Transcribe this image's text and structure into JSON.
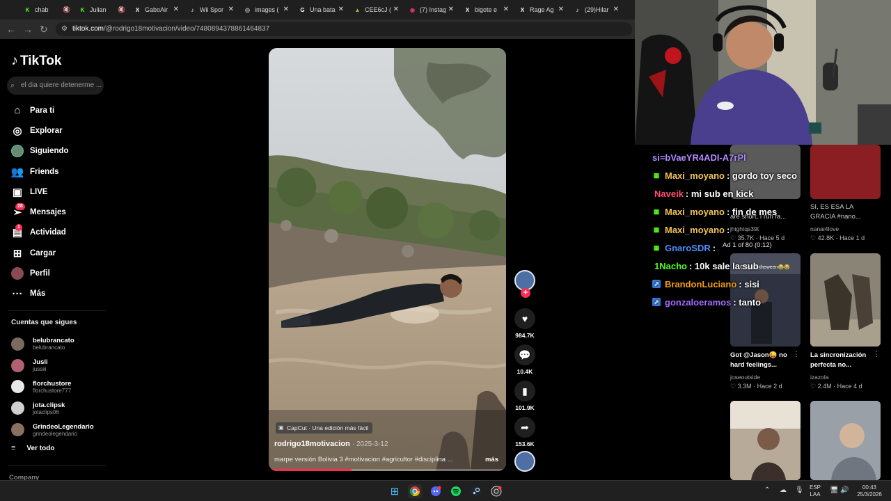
{
  "browser": {
    "tabs": [
      {
        "title": "chab",
        "fav": "K",
        "fav_color": "#53fc18",
        "muted": true
      },
      {
        "title": "Julian",
        "fav": "K",
        "fav_color": "#53fc18",
        "muted": true
      },
      {
        "title": "GaboAir",
        "fav": "X",
        "fav_color": "#ffffff",
        "muted": false
      },
      {
        "title": "Wii Spor",
        "fav": "♪",
        "fav_color": "#ffffff",
        "muted": false
      },
      {
        "title": "images (",
        "fav": "◎",
        "fav_color": "#bbbbbb",
        "muted": false
      },
      {
        "title": "Una bata",
        "fav": "G",
        "fav_color": "#ffffff",
        "muted": false
      },
      {
        "title": "CEE6cJ (",
        "fav": "▲",
        "fav_color": "#8bc34a",
        "muted": false
      },
      {
        "title": "(7) Instag",
        "fav": "◉",
        "fav_color": "#e1306c",
        "muted": false
      },
      {
        "title": "bigote e",
        "fav": "X",
        "fav_color": "#ffffff",
        "muted": false
      },
      {
        "title": "Rage Ag",
        "fav": "X",
        "fav_color": "#ffffff",
        "muted": false
      },
      {
        "title": "(29)Hilar",
        "fav": "♪",
        "fav_color": "#ffffff",
        "muted": false
      }
    ],
    "url_host": "tiktok.com",
    "url_path": "/@rodrigo18motivacion/video/7480894378861464837"
  },
  "sidebar": {
    "logo_text": "TikTok",
    "search_placeholder": "el dia quiere detenerme ...",
    "nav": [
      {
        "label": "Para ti",
        "icon": "home-icon",
        "glyph": "⌂"
      },
      {
        "label": "Explorar",
        "icon": "compass-icon",
        "glyph": "◎"
      },
      {
        "label": "Siguiendo",
        "icon": "following-avatar",
        "glyph": ""
      },
      {
        "label": "Friends",
        "icon": "friends-icon",
        "glyph": "👥"
      },
      {
        "label": "LIVE",
        "icon": "live-icon",
        "glyph": "▣"
      },
      {
        "label": "Mensajes",
        "icon": "messages-icon",
        "glyph": "➢",
        "badge": "28"
      },
      {
        "label": "Actividad",
        "icon": "activity-icon",
        "glyph": "▤",
        "badge": "1"
      },
      {
        "label": "Cargar",
        "icon": "upload-icon",
        "glyph": "⊞"
      },
      {
        "label": "Perfil",
        "icon": "profile-avatar",
        "glyph": "●"
      },
      {
        "label": "Más",
        "icon": "more-icon",
        "glyph": "···"
      }
    ],
    "following_title": "Cuentas que sigues",
    "following": [
      {
        "name": "belubrancato",
        "handle": "belubrancato",
        "color": "#7a6a60"
      },
      {
        "name": "Jusli",
        "handle": "jussiii",
        "color": "#b06070"
      },
      {
        "name": "florchustore",
        "handle": "florchustore777",
        "color": "#e8e8e8"
      },
      {
        "name": "jota.clipsk",
        "handle": "jotaclips06",
        "color": "#d0d0d0"
      },
      {
        "name": "GrindeoLegendario",
        "handle": "grindeolegendario",
        "color": "#8a7060"
      }
    ],
    "see_all": "Ver todo",
    "company": "Company"
  },
  "video": {
    "capcut": "CapCut · Una edición más fácil",
    "author": "rodrigo18motivacion",
    "date": "2025-3-12",
    "description": "marpe versión Bolivia 3 #motivacion #agricultor #disciplina ...",
    "more": "más",
    "progress": 0.35
  },
  "actions": {
    "likes": "984.7K",
    "comments": "10.4K",
    "saves": "101.9K",
    "shares": "153.6K"
  },
  "feed": [
    {
      "title": "",
      "user": "",
      "stats": "",
      "title2": "are short, I run fa...",
      "user2": "jhightqs39t",
      "likes": "35.7K",
      "when": "Hace 5 d"
    },
    {
      "title": "SI, ES ESA LA GRACIA #nano...",
      "user": "nanai4love",
      "likes": "42.8K",
      "when": "Hace 1 d"
    },
    {
      "title": "Got @Jason😜 no hard feelings...",
      "user": "joseoutside",
      "likes": "3.3M",
      "when": "Hace 2 d"
    },
    {
      "title": "La sincronización perfecta no...",
      "user": "izazola",
      "likes": "2.4M",
      "when": "Hace 4 d"
    }
  ],
  "feed_overlay_text": "On jasontheween😂😂",
  "chat": [
    {
      "user": "",
      "message": "si=bVaeYR4ADI-A7rPl",
      "user_color": "#b18cff",
      "badge": ""
    },
    {
      "user": "Maxi_moyano",
      "message": ": gordo toy seco",
      "user_color": "#f3c356",
      "badge": "▦"
    },
    {
      "user": "Naveik",
      "message": ": mi sub en kick",
      "user_color": "#ff4d6d",
      "badge": ""
    },
    {
      "user": "Maxi_moyano",
      "message": ": fin de mes",
      "user_color": "#f3c356",
      "badge": "▦"
    },
    {
      "user": "Maxi_moyano",
      "message": ":",
      "user_color": "#f3c356",
      "badge": "▦"
    },
    {
      "user": "GnaroSDR",
      "message": ":",
      "user_color": "#4f8cff",
      "badge": "▦"
    },
    {
      "user": "1Nacho",
      "message": ": 10k sale la sub",
      "user_color": "#53fc18",
      "badge": ""
    },
    {
      "user": "BrandonLuciano",
      "message": ": sisi",
      "user_color": "#f39c12",
      "badge": "⇗"
    },
    {
      "user": "gonzaloeramos",
      "message": ": tanto",
      "user_color": "#a06cff",
      "badge": "⇗"
    }
  ],
  "ad_label": "Ad 1 of 80 (0:12)",
  "taskbar": {
    "lang_top": "ESP",
    "lang_bottom": "LAA",
    "time": "00:43",
    "date": "25/3/2026"
  },
  "colors": {
    "accent": "#fe2c55",
    "kick_green": "#53fc18"
  }
}
